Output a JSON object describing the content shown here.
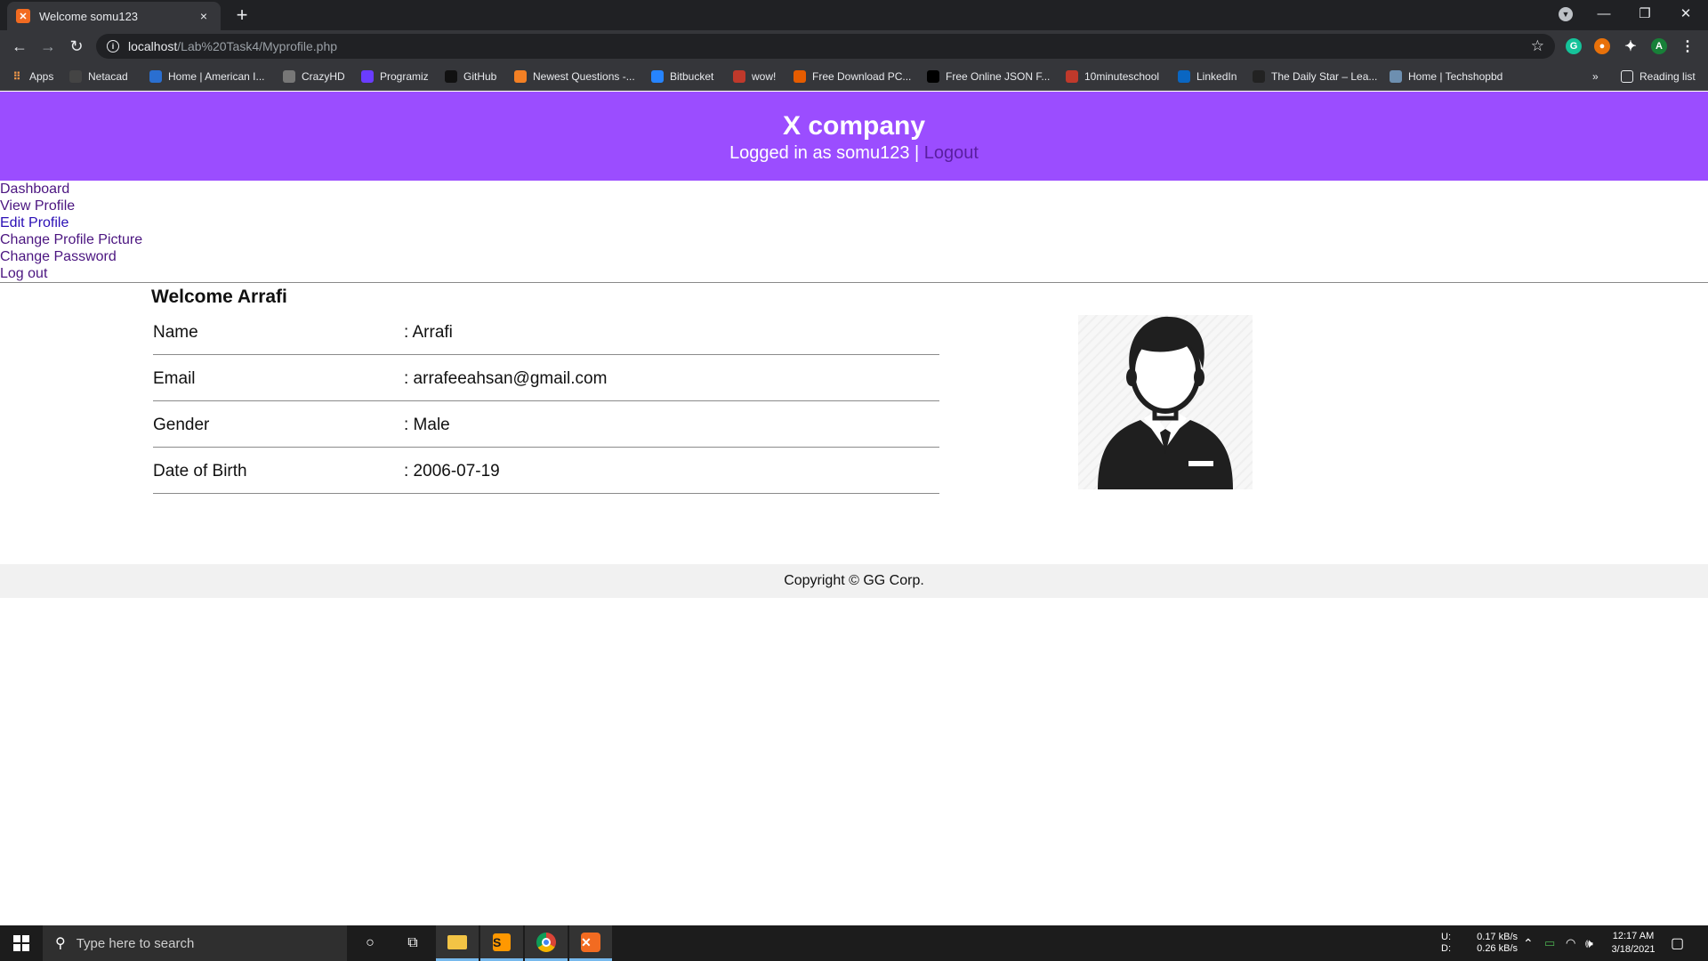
{
  "browser": {
    "tab_title": "Welcome somu123",
    "tab_favicon": "xampp-icon",
    "new_tab": "+",
    "close_tab": "×",
    "url_host": "localhost",
    "url_path": "/Lab%20Task4/Myprofile.php",
    "profile_initial": "A",
    "apps_label": "Apps",
    "reading_list": "Reading list",
    "overflow": "»",
    "bookmarks": [
      {
        "label": "Netacad",
        "color": "#444444"
      },
      {
        "label": "Home | American I...",
        "color": "#2a6fd1"
      },
      {
        "label": "CrazyHD",
        "color": "#777777"
      },
      {
        "label": "Programiz",
        "color": "#6a3cff"
      },
      {
        "label": "GitHub",
        "color": "#111111"
      },
      {
        "label": "Newest Questions -...",
        "color": "#f48024"
      },
      {
        "label": "Bitbucket",
        "color": "#2684ff"
      },
      {
        "label": "wow!",
        "color": "#c0392b"
      },
      {
        "label": "Free Download PC...",
        "color": "#e65c00"
      },
      {
        "label": "Free Online JSON F...",
        "color": "#000000"
      },
      {
        "label": "10minuteschool",
        "color": "#c0392b"
      },
      {
        "label": "LinkedIn",
        "color": "#0a66c2"
      },
      {
        "label": "The Daily Star – Lea...",
        "color": "#222222"
      },
      {
        "label": "Home | Techshopbd",
        "color": "#6d8fb0"
      }
    ]
  },
  "site": {
    "title": "X company",
    "logged_in_prefix": "Logged in as somu123",
    "separator": " | ",
    "logout": "Logout"
  },
  "nav": [
    {
      "label": "Dashboard"
    },
    {
      "label": "View Profile"
    },
    {
      "label": "Edit Profile"
    },
    {
      "label": "Change Profile Picture"
    },
    {
      "label": "Change Password"
    },
    {
      "label": "Log out"
    }
  ],
  "profile": {
    "welcome": "Welcome Arrafi",
    "rows": [
      {
        "label": "Name",
        "value": ": Arrafi"
      },
      {
        "label": "Email",
        "value": ": arrafeeahsan@gmail.com"
      },
      {
        "label": "Gender",
        "value": ": Male"
      },
      {
        "label": "Date of Birth",
        "value": ": 2006-07-19"
      }
    ]
  },
  "footer": {
    "text": "Copyright © GG Corp."
  },
  "taskbar": {
    "search_placeholder": "Type here to search",
    "net_up_label": "U:",
    "net_down_label": "D:",
    "net_up": "0.17 kB/s",
    "net_down": "0.26 kB/s",
    "time": "12:17 AM",
    "date": "3/18/2021"
  }
}
